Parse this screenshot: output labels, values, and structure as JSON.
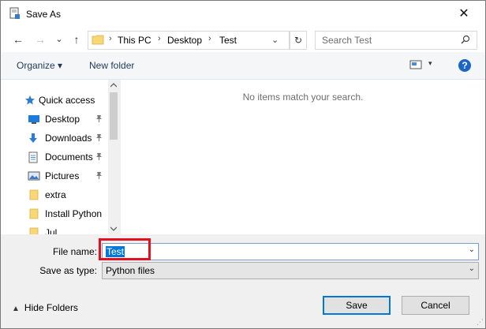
{
  "window": {
    "title": "Save As",
    "close_glyph": "✕"
  },
  "navbar": {
    "back_glyph": "←",
    "forward_glyph": "→",
    "recent_glyph": "⌄",
    "up_glyph": "↑",
    "breadcrumb": [
      "This PC",
      "Desktop",
      "Test"
    ],
    "separator": "›",
    "refresh_glyph": "↻",
    "search_placeholder": "Search Test"
  },
  "toolbar": {
    "organize_label": "Organize ▾",
    "new_folder_label": "New folder",
    "view_caret": "▾",
    "help_label": "?"
  },
  "nav_pane": {
    "items": [
      {
        "label": "Quick access",
        "icon": "star-icon",
        "pinned": false
      },
      {
        "label": "Desktop",
        "icon": "desktop-icon",
        "pinned": true
      },
      {
        "label": "Downloads",
        "icon": "download-icon",
        "pinned": true
      },
      {
        "label": "Documents",
        "icon": "document-icon",
        "pinned": true
      },
      {
        "label": "Pictures",
        "icon": "pictures-icon",
        "pinned": true
      },
      {
        "label": "extra",
        "icon": "folder-icon",
        "pinned": false
      },
      {
        "label": "Install Python",
        "icon": "folder-icon",
        "pinned": false
      },
      {
        "label": "Jul",
        "icon": "folder-icon",
        "pinned": false
      }
    ],
    "pin_glyph": "📌"
  },
  "content": {
    "empty_message": "No items match your search."
  },
  "form": {
    "file_name_label": "File name:",
    "file_name_value": "Test",
    "save_as_type_label": "Save as type:",
    "save_as_type_value": "Python files",
    "caret": "⌄"
  },
  "footer": {
    "hide_folders_caret": "▲",
    "hide_folders_label": "Hide Folders",
    "save_label": "Save",
    "cancel_label": "Cancel"
  },
  "colors": {
    "accent": "#0078d7",
    "highlight_box": "#e3101f",
    "help_icon": "#1c65c8"
  }
}
